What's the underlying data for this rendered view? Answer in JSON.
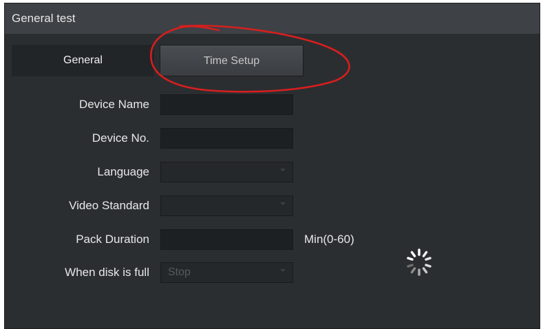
{
  "window": {
    "title": "General test"
  },
  "tabs": [
    {
      "label": "General",
      "active": true
    },
    {
      "label": "Time Setup",
      "active": false
    }
  ],
  "form": {
    "device_name": {
      "label": "Device Name",
      "value": ""
    },
    "device_no": {
      "label": "Device No.",
      "value": ""
    },
    "language": {
      "label": "Language",
      "value": ""
    },
    "video_standard": {
      "label": "Video Standard",
      "value": ""
    },
    "pack_duration": {
      "label": "Pack Duration",
      "value": "",
      "suffix": "Min(0-60)"
    },
    "disk_full": {
      "label": "When disk is full",
      "value": "Stop"
    }
  },
  "colors": {
    "background": "#2b2e31",
    "titlebar": "#3e4145",
    "annotation": "#d81e1e"
  },
  "icons": {
    "loading": "loading-spinner-icon"
  }
}
